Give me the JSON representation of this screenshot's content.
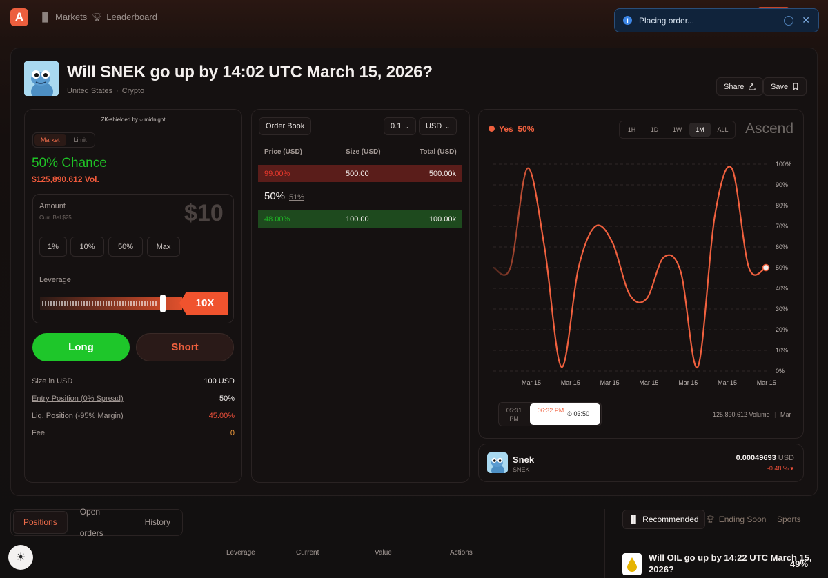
{
  "nav": {
    "logo": "A",
    "items": [
      {
        "label": "Markets",
        "icon": "bar-chart-icon"
      },
      {
        "label": "Leaderboard",
        "icon": "trophy-icon"
      }
    ]
  },
  "toast": {
    "message": "Placing order..."
  },
  "market": {
    "title": "Will SNEK go up by 14:02 UTC March 15, 2026?",
    "region": "United States",
    "category": "Crypto",
    "share_label": "Share",
    "save_label": "Save"
  },
  "trade": {
    "zk_label": "ZK-shielded by",
    "zk_brand": "midnight",
    "tabs": [
      "Market",
      "Limit"
    ],
    "chance": "50% Chance",
    "volume": "$125,890.612 Vol.",
    "amount_label": "Amount",
    "balance": "Curr. Bal $25",
    "amount_value": "$10",
    "quick": [
      "1%",
      "10%",
      "50%",
      "Max"
    ],
    "leverage_label": "Leverage",
    "leverage_value": "10X",
    "leverage_fraction": 0.94,
    "long_label": "Long",
    "short_label": "Short",
    "summary": [
      {
        "label": "Size in USD",
        "value": "100 USD",
        "underline": false,
        "color": "#f3efed"
      },
      {
        "label": "Entry Position (0% Spread)",
        "value": "50%",
        "underline": true,
        "color": "#f3efed"
      },
      {
        "label": "Liq. Position (-95% Margin)",
        "value": "45.00%",
        "underline": true,
        "color": "#f0503a"
      },
      {
        "label": "Fee",
        "value": "0",
        "underline": false,
        "color": "#f09a3c"
      }
    ]
  },
  "orderbook": {
    "title": "Order Book",
    "tick": "0.1",
    "currency": "USD",
    "headers": [
      "Price (USD)",
      "Size (USD)",
      "Total (USD)"
    ],
    "ask": {
      "price": "99.00%",
      "size": "500.00",
      "total": "500.00k"
    },
    "mid": {
      "price": "50%",
      "spread": "51%"
    },
    "bid": {
      "price": "48.00%",
      "size": "100.00",
      "total": "100.00k"
    }
  },
  "chart": {
    "outcome": "Yes",
    "outcome_value": "50%",
    "timeframes": [
      "1H",
      "1D",
      "1W",
      "1M",
      "ALL"
    ],
    "active_timeframe": "1M",
    "brand": "Ascend",
    "time_prev": "05:31 PM",
    "time_current": "06:32 PM",
    "countdown": "03:50",
    "volume": "125,890.612 Volume",
    "volume_suffix": "Mar"
  },
  "chart_data": {
    "type": "line",
    "y_ticks": [
      "100%",
      "90%",
      "80%",
      "70%",
      "60%",
      "50%",
      "40%",
      "30%",
      "20%",
      "10%",
      "0%"
    ],
    "x_ticks": [
      "Mar 15",
      "Mar 15",
      "Mar 15",
      "Mar 15",
      "Mar 15",
      "Mar 15",
      "Mar 15"
    ],
    "ylim": [
      0,
      100
    ],
    "grid": true,
    "series": [
      {
        "name": "Yes",
        "color": "#f0603e",
        "values": [
          50,
          50,
          98,
          60,
          2,
          50,
          70,
          62,
          37,
          35,
          55,
          48,
          2,
          75,
          98,
          50,
          50
        ]
      }
    ]
  },
  "asset": {
    "name": "Snek",
    "ticker": "SNEK",
    "price": "0.00049693",
    "currency": "USD",
    "change": "-0.48 %"
  },
  "positions": {
    "tabs": [
      "Positions",
      "Open orders",
      "History"
    ],
    "columns": [
      "Leverage",
      "Current",
      "Value",
      "Actions"
    ]
  },
  "sidebar": {
    "tabs": [
      "Recommended",
      "Ending Soon",
      "Sports"
    ],
    "item_title": "Will OIL go up by 14:22 UTC March 15, 2026?",
    "item_value": "49%"
  }
}
